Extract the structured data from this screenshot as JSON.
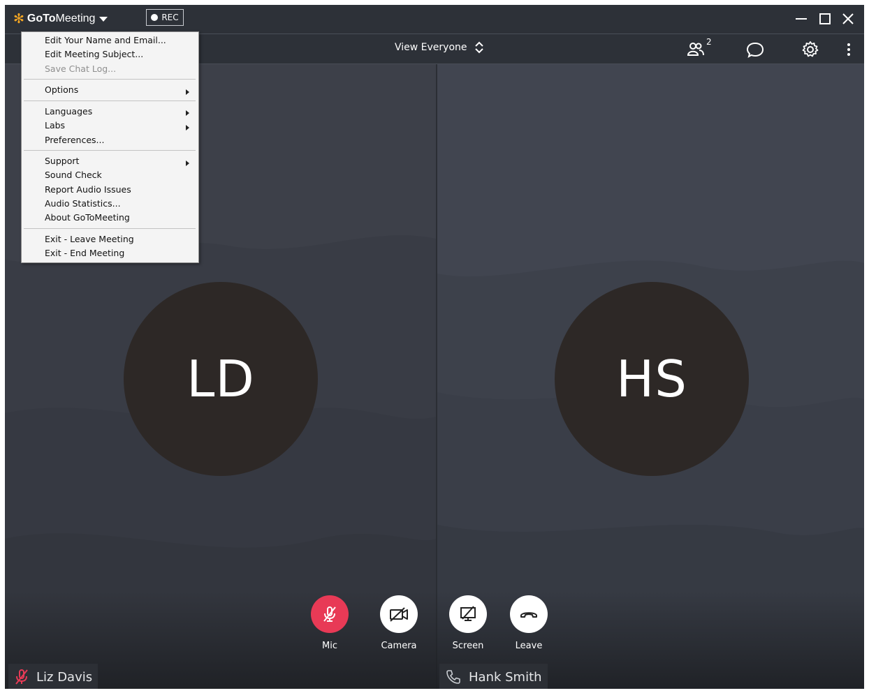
{
  "titlebar": {
    "brand_bold": "GoTo",
    "brand_regular": "Meeting",
    "rec_label": "REC"
  },
  "toolbar": {
    "view_label": "View Everyone",
    "participant_count": "2"
  },
  "menu": {
    "items": [
      {
        "label": "Edit Your Name and Email...",
        "enabled": true
      },
      {
        "label": "Edit Meeting Subject...",
        "enabled": true
      },
      {
        "label": "Save Chat Log...",
        "enabled": false
      },
      {
        "label": "Options",
        "submenu": true
      },
      {
        "label": "Languages",
        "submenu": true
      },
      {
        "label": "Labs",
        "submenu": true
      },
      {
        "label": "Preferences...",
        "enabled": true
      },
      {
        "label": "Support",
        "submenu": true
      },
      {
        "label": "Sound Check",
        "enabled": true
      },
      {
        "label": "Report Audio Issues",
        "enabled": true
      },
      {
        "label": "Audio Statistics...",
        "enabled": true
      },
      {
        "label": "About GoToMeeting",
        "enabled": true
      },
      {
        "label": "Exit - Leave Meeting",
        "enabled": true
      },
      {
        "label": "Exit - End Meeting",
        "enabled": true
      }
    ]
  },
  "participants": {
    "left": {
      "initials": "LD",
      "name": "Liz Davis"
    },
    "right": {
      "initials": "HS",
      "name": "Hank Smith"
    }
  },
  "controls": {
    "mic": "Mic",
    "camera": "Camera",
    "screen": "Screen",
    "leave": "Leave"
  },
  "colors": {
    "mic_muted": "#e83a56",
    "logo_orange": "#f5a623",
    "avatar_bg": "#2d2826"
  }
}
